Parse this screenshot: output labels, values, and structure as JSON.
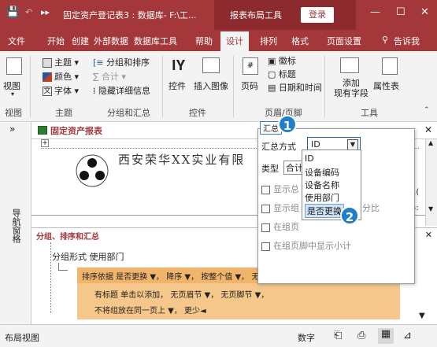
{
  "titlebar": {
    "doc_title": "固定资产登记表3 : 数据库- F:\\工...",
    "context_tab": "报表布局工具",
    "login": "登录"
  },
  "menu": [
    "文件",
    "开始",
    "创建",
    "外部数据",
    "数据库工具",
    "帮助",
    "设计",
    "排列",
    "格式",
    "页面设置",
    "告诉我"
  ],
  "ribbon": {
    "view": "视图",
    "theme": "主题",
    "colors": "颜色",
    "fonts": "字体",
    "group_sort": "分组和排序",
    "totals": "合计",
    "hide_details": "隐藏详细信息",
    "controls": "控件",
    "insert_image": "插入图像",
    "page_number": "页码",
    "logo": "徽标",
    "title": "标题",
    "date_time": "日期和时间",
    "add_fields": "添加\n现有字段",
    "properties": "属性表",
    "groups": [
      "视图",
      "主题",
      "分组和汇总",
      "控件",
      "页眉/页脚",
      "工具"
    ]
  },
  "nav": {
    "label": "导航窗格"
  },
  "doc": {
    "tab": "固定资产报表",
    "company": "西安荣华XX实业有限"
  },
  "groupsort": {
    "title": "分组、排序和汇总",
    "group_on": "分组形式 使用部门",
    "sort_line": "排序依据 是否更换 ▼， 降序 ▼， 按整个值 ▼， 无汇总 ▼，",
    "opt_line1": "有标题 单击以添加， 无页眉节 ▼， 无页脚节 ▼，",
    "opt_line2": "不将组放在同一页上 ▼， 更少◄"
  },
  "popup": {
    "header": "汇总",
    "method_label": "汇总方式",
    "method_value": "ID",
    "type_label": "类型",
    "type_value": "合计",
    "check1": "显示总",
    "check2": "显示组",
    "check2_suffix": "分比",
    "check3": "在组页",
    "check4": "在组页脚中显示小计",
    "options": [
      "ID",
      "设备编码",
      "设备名称",
      "使用部门",
      "是否更换"
    ],
    "selected": "是否更换"
  },
  "badges": [
    "1",
    "2"
  ],
  "status": {
    "left": "布局视图",
    "numlock": "数字"
  },
  "colors": {
    "brand": "#a4373a",
    "badge": "#1f7fc8",
    "orange": "#f5c78a"
  }
}
